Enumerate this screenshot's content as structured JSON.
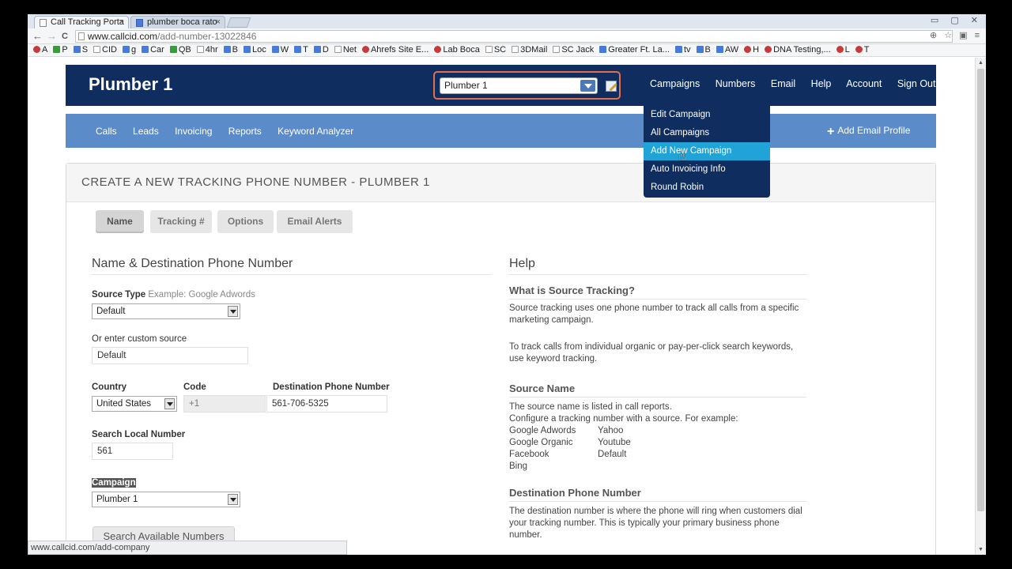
{
  "browser": {
    "tabs": [
      {
        "title": "Call Tracking Porta",
        "close": "×"
      },
      {
        "title": "plumber boca rato",
        "close": "×"
      }
    ],
    "window_buttons": "▭ ▢ ✕",
    "nav": {
      "back": "←",
      "forward": "→",
      "reload": "C"
    },
    "url_host": "www.callcid.com",
    "url_path": "/add-number-13022846",
    "address_icons": "⊕ ☆ ▣ ≡",
    "bookmarks": [
      {
        "label": "A",
        "icon": "red"
      },
      {
        "label": "P",
        "icon": "grn"
      },
      {
        "label": "S",
        "icon": "blue"
      },
      {
        "label": "CID",
        "icon": "doc"
      },
      {
        "label": "g",
        "icon": "blue"
      },
      {
        "label": "Car",
        "icon": "blue"
      },
      {
        "label": "QB",
        "icon": "grn"
      },
      {
        "label": "4hr",
        "icon": "doc"
      },
      {
        "label": "B",
        "icon": "blue"
      },
      {
        "label": "Loc",
        "icon": "blue"
      },
      {
        "label": "W",
        "icon": "blue"
      },
      {
        "label": "T",
        "icon": "blue"
      },
      {
        "label": "D",
        "icon": "blue"
      },
      {
        "label": "Net",
        "icon": "doc"
      },
      {
        "label": "Ahrefs Site E...",
        "icon": "red"
      },
      {
        "label": "Lab Boca",
        "icon": "red"
      },
      {
        "label": "SC",
        "icon": "doc"
      },
      {
        "label": "3DMail",
        "icon": "doc"
      },
      {
        "label": "SC Jack",
        "icon": "doc"
      },
      {
        "label": "Greater Ft. La...",
        "icon": "blue"
      },
      {
        "label": "tv",
        "icon": "blue"
      },
      {
        "label": "B",
        "icon": "blue"
      },
      {
        "label": "AW",
        "icon": "blue"
      },
      {
        "label": "H",
        "icon": "red"
      },
      {
        "label": "DNA Testing,...",
        "icon": "red"
      },
      {
        "label": "L",
        "icon": "red"
      },
      {
        "label": "T",
        "icon": "red"
      }
    ],
    "status_url": "www.callcid.com/add-company"
  },
  "header": {
    "brand": "Plumber 1",
    "campaign_selected": "Plumber 1",
    "nav": [
      "Campaigns",
      "Numbers",
      "Email",
      "Help",
      "Account",
      "Sign Out"
    ]
  },
  "subnav": {
    "items": [
      "Calls",
      "Leads",
      "Invoicing",
      "Reports",
      "Keyword Analyzer"
    ],
    "add_email_plus": "+",
    "add_email": "Add Email Profile"
  },
  "dropdown": {
    "items": [
      "Edit Campaign",
      "All Campaigns",
      "Add New Campaign",
      "Auto Invoicing Info",
      "Round Robin"
    ],
    "highlighted_index": 2
  },
  "panel": {
    "title": "CREATE A NEW TRACKING PHONE NUMBER - PLUMBER 1",
    "steps": [
      "Name",
      "Tracking #",
      "Options",
      "Email Alerts"
    ],
    "active_step": 0
  },
  "form": {
    "section_title": "Name & Destination Phone Number",
    "source_type_label": "Source Type",
    "source_type_hint": "Example: Google Adwords",
    "source_type_value": "Default",
    "custom_source_label": "Or enter custom source",
    "custom_source_value": "Default",
    "country_label": "Country",
    "country_value": "United States",
    "code_label": "Code",
    "code_value": "+1",
    "dest_label": "Destination Phone Number",
    "dest_value": "561-706-5325",
    "local_label": "Search Local Number",
    "local_value": "561",
    "campaign_label": "Campaign",
    "campaign_value": "Plumber 1",
    "search_button": "Search Available Numbers"
  },
  "help": {
    "title": "Help",
    "q1": "What is Source Tracking?",
    "p1": "Source tracking uses one phone number to track all calls from a specific marketing campaign.",
    "p2": "To track calls from individual organic or pay-per-click search keywords, use keyword tracking.",
    "q2": "Source Name",
    "p3a": "The source name is listed in call reports.",
    "p3b": "Configure a tracking number with a source. For example:",
    "examples_left": [
      "Google Adwords",
      "Google Organic",
      "Facebook",
      "Bing"
    ],
    "examples_right": [
      "Yahoo",
      "Youtube",
      "Default"
    ],
    "q3": "Destination Phone Number",
    "p4": "The destination number is where the phone will ring when customers dial your tracking number. This is typically your primary business phone number."
  },
  "colors": {
    "header_bg": "#0f2d5f",
    "subnav_bg": "#5b8cc9",
    "dropdown_highlight": "#20a4d8",
    "select_outline": "#e26d4f"
  }
}
